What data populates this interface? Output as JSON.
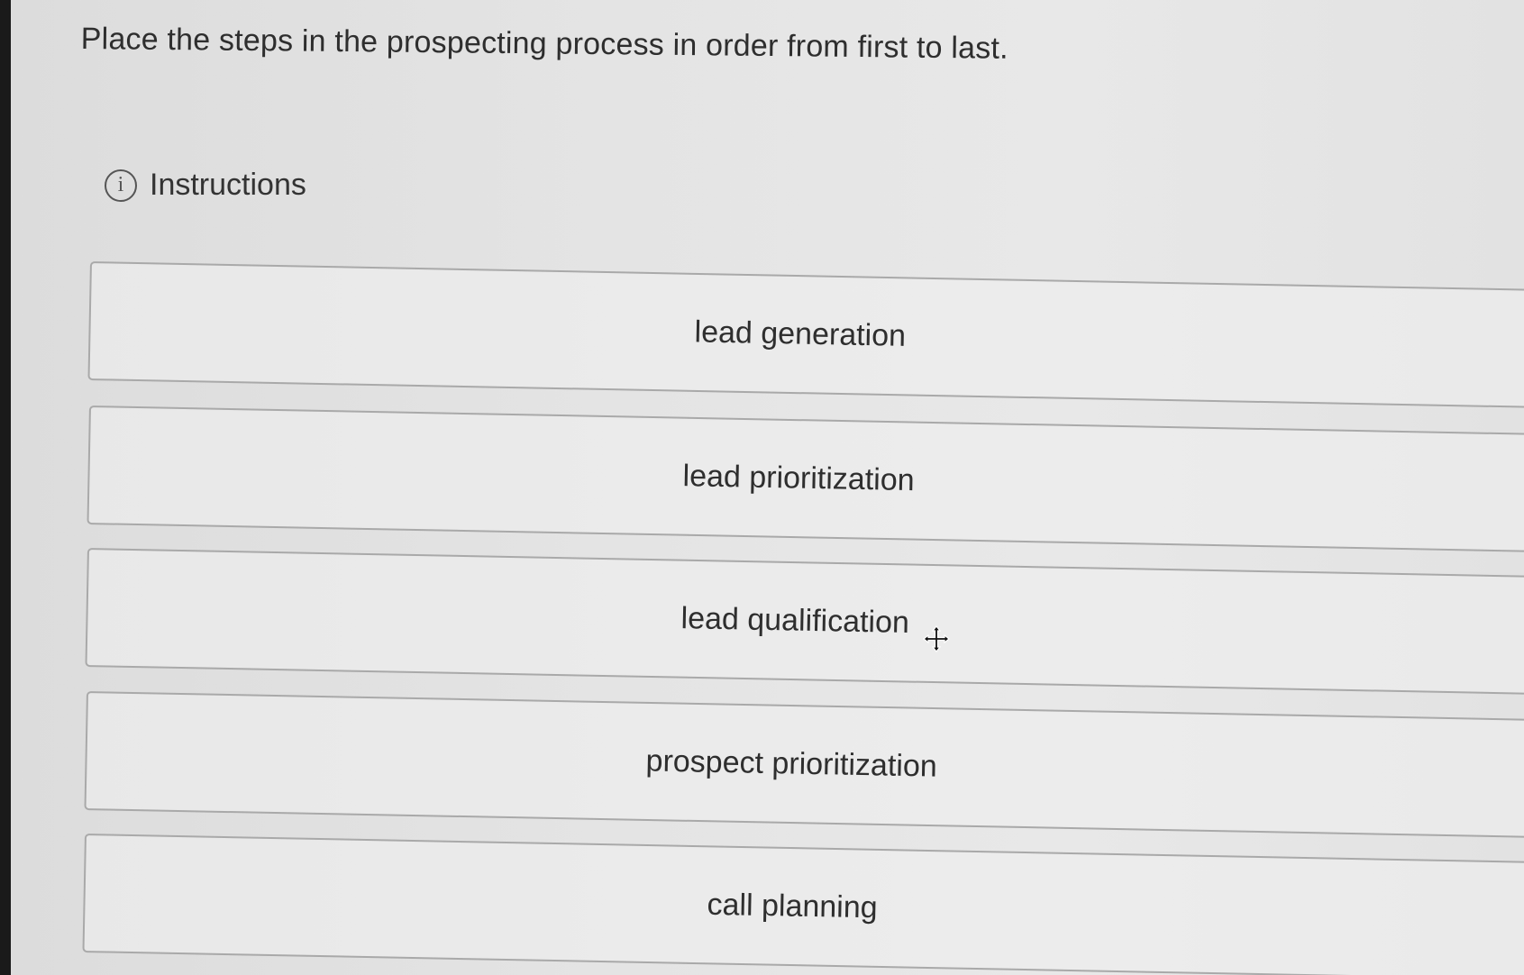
{
  "question": {
    "prompt": "Place the steps in the prospecting process in order from first to last."
  },
  "instructions": {
    "label": "Instructions",
    "icon": "info-circle-icon",
    "glyph": "i"
  },
  "steps": [
    {
      "label": "lead generation"
    },
    {
      "label": "lead prioritization"
    },
    {
      "label": "lead qualification"
    },
    {
      "label": "prospect prioritization"
    },
    {
      "label": "call planning"
    }
  ],
  "cursor": {
    "icon": "move-cursor-icon"
  }
}
